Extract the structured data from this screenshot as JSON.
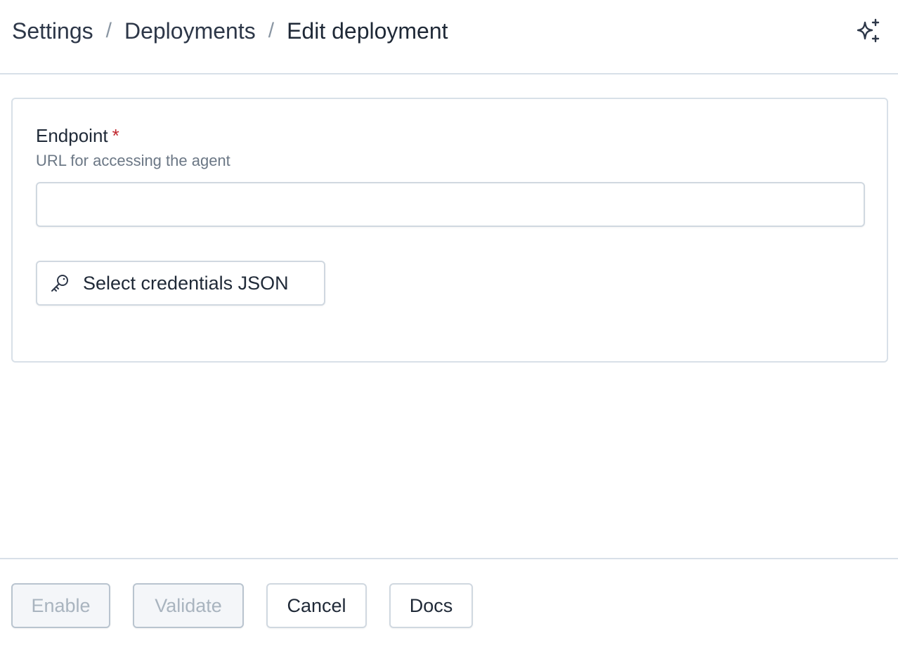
{
  "breadcrumb": {
    "items": [
      "Settings",
      "Deployments",
      "Edit deployment"
    ],
    "separator": "/"
  },
  "header": {
    "assistant_icon": "sparkle-icon"
  },
  "form": {
    "endpoint": {
      "label": "Endpoint",
      "required_marker": "*",
      "help": "URL for accessing the agent",
      "value": "",
      "placeholder": ""
    },
    "credentials_button": {
      "label": "Select credentials JSON",
      "icon": "key-icon"
    }
  },
  "footer": {
    "enable_label": "Enable",
    "validate_label": "Validate",
    "cancel_label": "Cancel",
    "docs_label": "Docs"
  },
  "colors": {
    "required": "#c0262d",
    "border": "#d8e0e8",
    "disabled_text": "#a9b4bf",
    "disabled_bg": "#f4f6f9"
  }
}
